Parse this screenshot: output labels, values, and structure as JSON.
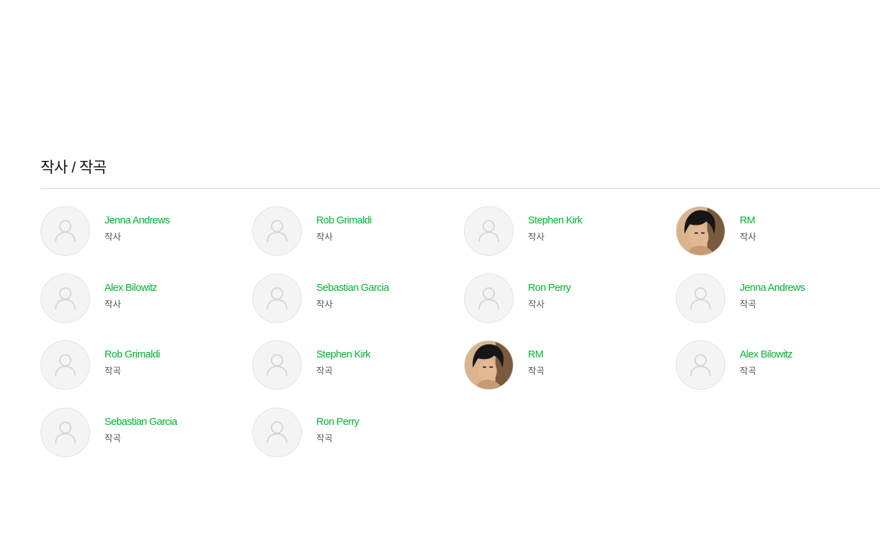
{
  "section": {
    "title": "작사 / 작곡"
  },
  "credits": [
    {
      "name": "Jenna Andrews",
      "role": "작사",
      "avatar": "placeholder"
    },
    {
      "name": "Rob Grimaldi",
      "role": "작사",
      "avatar": "placeholder"
    },
    {
      "name": "Stephen Kirk",
      "role": "작사",
      "avatar": "placeholder"
    },
    {
      "name": "RM",
      "role": "작사",
      "avatar": "photo"
    },
    {
      "name": "Alex Bilowitz",
      "role": "작사",
      "avatar": "placeholder"
    },
    {
      "name": "Sebastian Garcia",
      "role": "작사",
      "avatar": "placeholder"
    },
    {
      "name": "Ron Perry",
      "role": "작사",
      "avatar": "placeholder"
    },
    {
      "name": "Jenna Andrews",
      "role": "작곡",
      "avatar": "placeholder"
    },
    {
      "name": "Rob Grimaldi",
      "role": "작곡",
      "avatar": "placeholder"
    },
    {
      "name": "Stephen Kirk",
      "role": "작곡",
      "avatar": "placeholder"
    },
    {
      "name": "RM",
      "role": "작곡",
      "avatar": "photo"
    },
    {
      "name": "Alex Bilowitz",
      "role": "작곡",
      "avatar": "placeholder"
    },
    {
      "name": "Sebastian Garcia",
      "role": "작곡",
      "avatar": "placeholder"
    },
    {
      "name": "Ron Perry",
      "role": "작곡",
      "avatar": "placeholder"
    }
  ],
  "colors": {
    "name_accent": "#00b630",
    "role_text": "#555555",
    "divider": "#d9d9d9",
    "avatar_bg": "#f4f4f4"
  },
  "icons": {
    "placeholder": "user-silhouette-icon",
    "photo": "artist-photo"
  }
}
